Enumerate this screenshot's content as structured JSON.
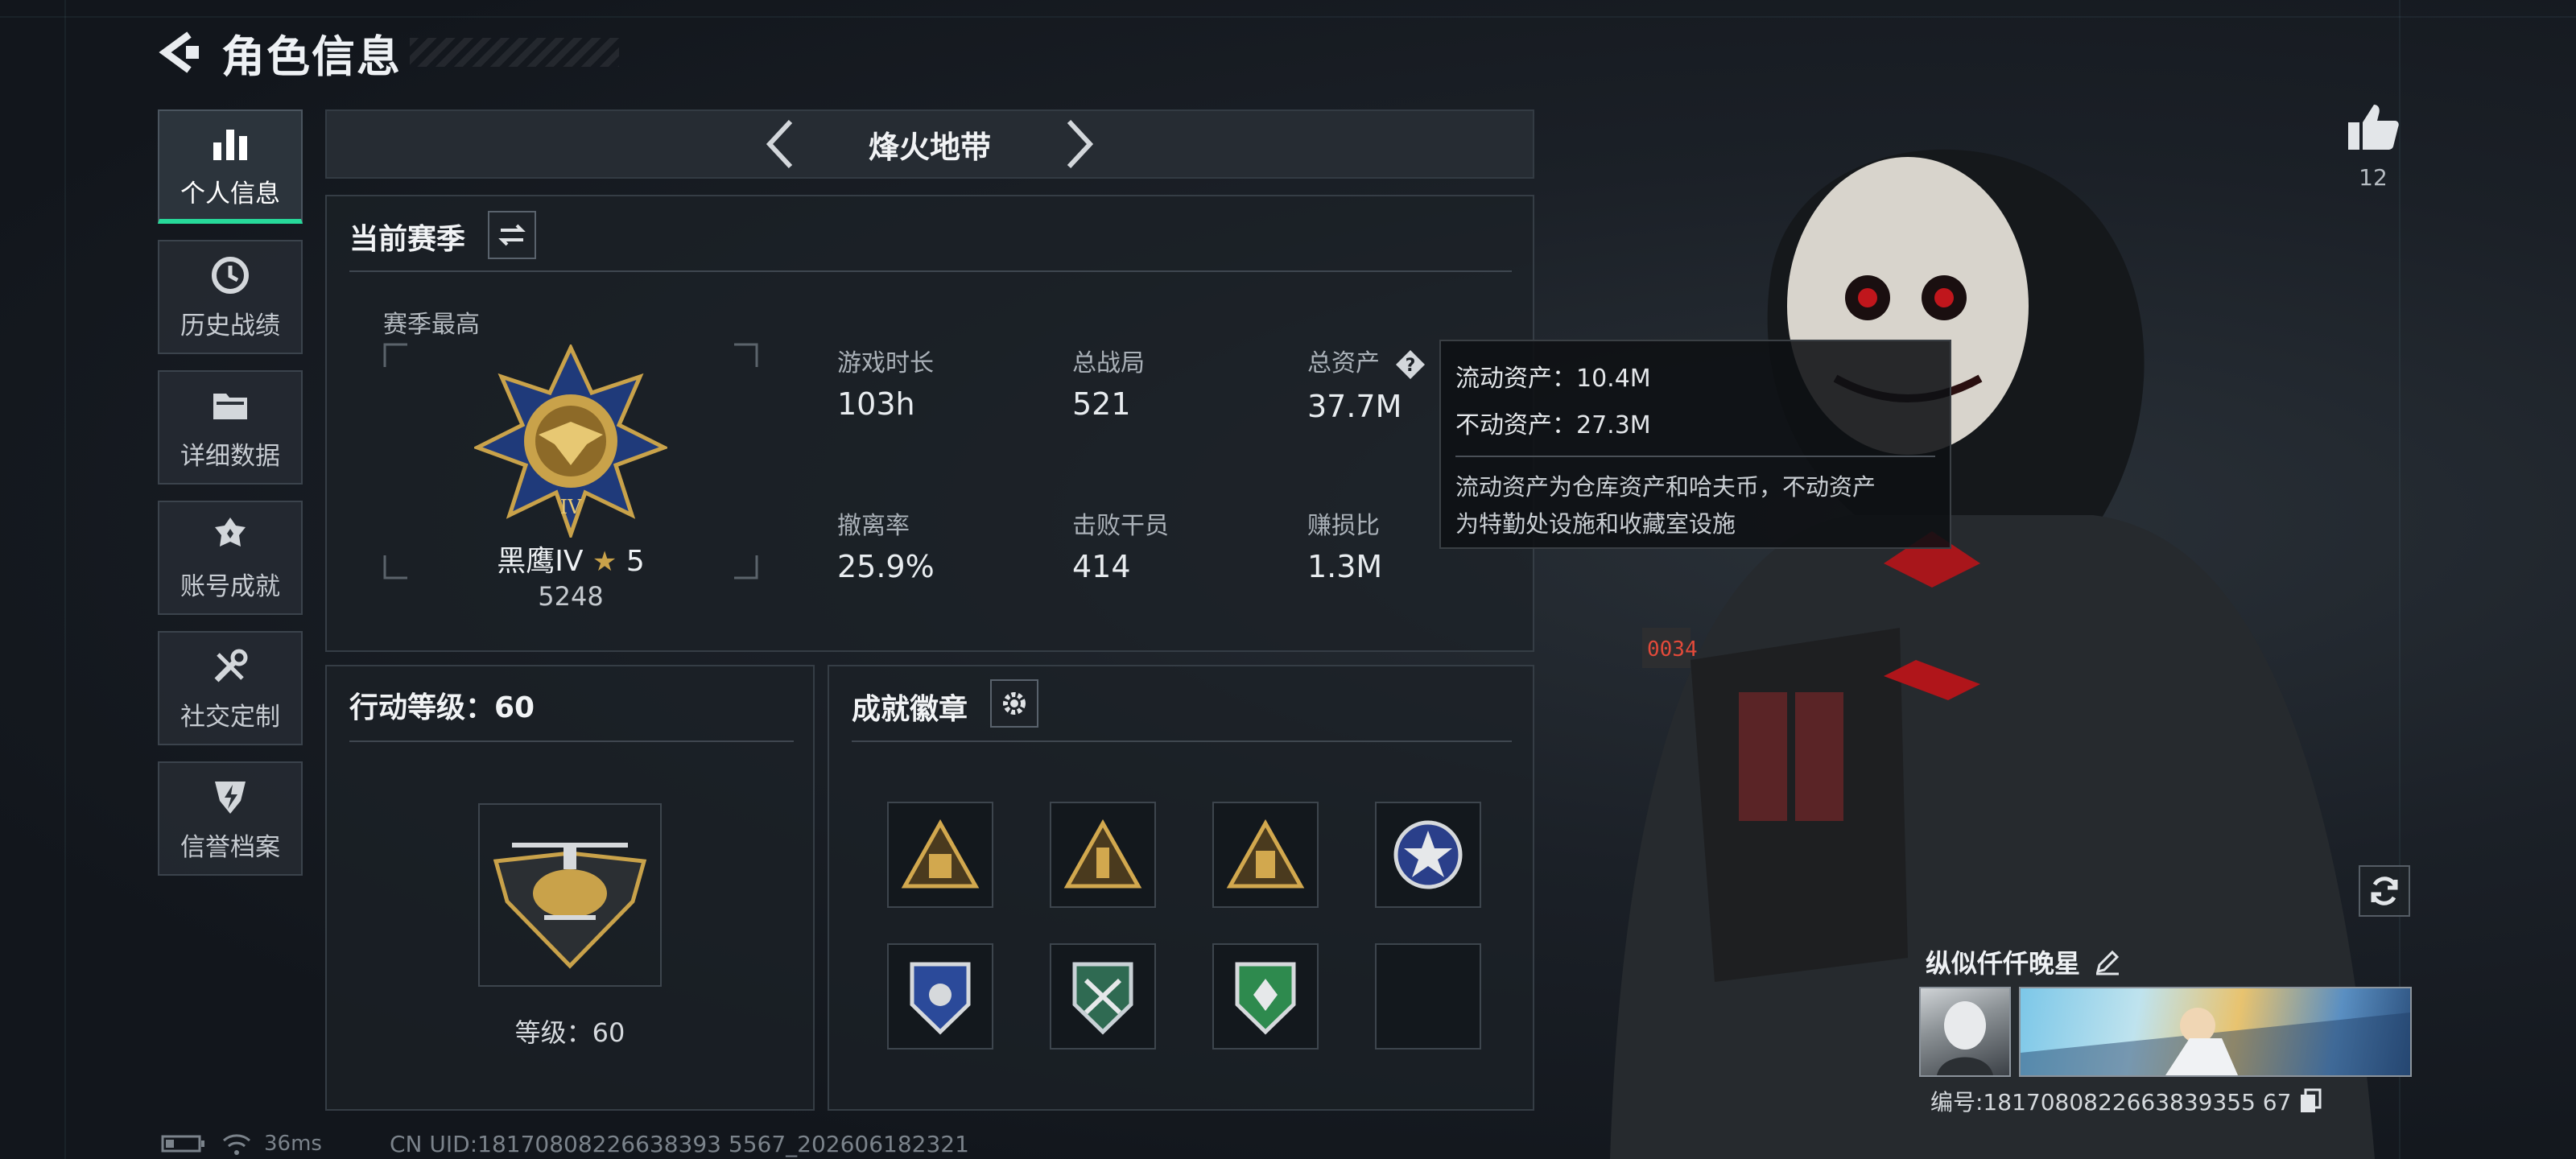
{
  "header": {
    "title": "角色信息"
  },
  "sidebar": {
    "items": [
      {
        "label": "个人信息",
        "active": true,
        "icon": "bar-chart-icon"
      },
      {
        "label": "历史战绩",
        "active": false,
        "icon": "history-clock-icon"
      },
      {
        "label": "详细数据",
        "active": false,
        "icon": "folder-icon"
      },
      {
        "label": "账号成就",
        "active": false,
        "icon": "achievement-icon"
      },
      {
        "label": "社交定制",
        "active": false,
        "icon": "wrench-icon"
      },
      {
        "label": "信誉档案",
        "active": false,
        "icon": "shield-bolt-icon"
      }
    ]
  },
  "mode": {
    "title": "烽火地带"
  },
  "season": {
    "title": "当前赛季",
    "best_label": "赛季最高",
    "rank_name": "黑鹰IV",
    "rank_stars": "5",
    "rank_points": "5248",
    "stats": [
      {
        "label": "游戏时长",
        "value": "103h"
      },
      {
        "label": "总战局",
        "value": "521"
      },
      {
        "label": "总资产",
        "value": "37.7M"
      },
      {
        "label": "撤离率",
        "value": "25.9%"
      },
      {
        "label": "击败干员",
        "value": "414"
      },
      {
        "label": "赚损比",
        "value": "1.3M"
      }
    ]
  },
  "tooltip": {
    "liquid": "流动资产：10.4M",
    "fixed": "不动资产：27.3M",
    "note_line1": "流动资产为仓库资产和哈夫币，不动资产",
    "note_line2": "为特勤处设施和收藏室设施"
  },
  "action_level": {
    "title": "行动等级：60",
    "level_text": "等级：60"
  },
  "achievements": {
    "title": "成就徽章"
  },
  "likes": {
    "count": "12"
  },
  "player": {
    "name": "纵似仟仟晚星",
    "id": "编号:1817080822663839355 67"
  },
  "status": {
    "ping": "36ms",
    "uid": "CN UID:18170808226638393 5567_202606182321"
  },
  "colors": {
    "accent": "#27d99a",
    "gold": "#c9a24a"
  }
}
